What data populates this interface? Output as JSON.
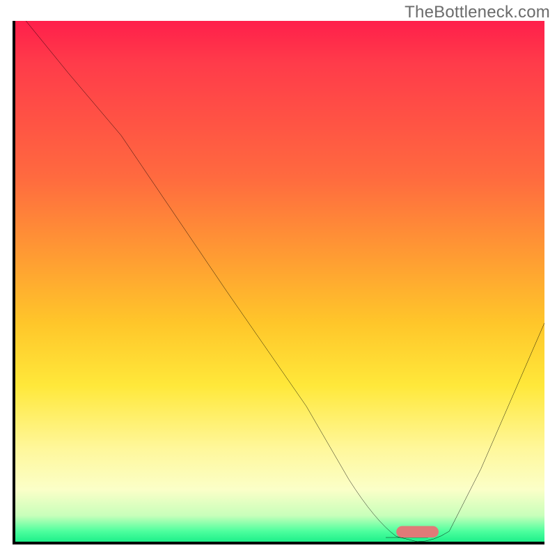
{
  "watermark": "TheBottleneck.com",
  "chart_data": {
    "type": "line",
    "title": "",
    "xlabel": "",
    "ylabel": "",
    "note": "Axes have no visible tick labels; values below are in relative 0–100 units along each axis (x left→right, y bottom→top).",
    "xlim": [
      0,
      100
    ],
    "ylim": [
      0,
      100
    ],
    "series": [
      {
        "name": "bottleneck-curve",
        "x": [
          2,
          10,
          20,
          24,
          40,
          55,
          63,
          68,
          72,
          76,
          82,
          88,
          94,
          100
        ],
        "y": [
          100,
          90,
          78,
          72,
          48,
          26,
          12,
          4,
          1,
          0,
          2,
          14,
          28,
          42
        ]
      }
    ],
    "marker": {
      "name": "optimal-point",
      "x": 76,
      "y": 1.5,
      "color": "#e07a78",
      "shape": "rounded-bar"
    },
    "background_gradient": {
      "top": "#ff1f4b",
      "mid_upper": "#ff9b33",
      "mid": "#ffe83a",
      "mid_lower": "#fbffc8",
      "bottom": "#1ef08a"
    }
  }
}
